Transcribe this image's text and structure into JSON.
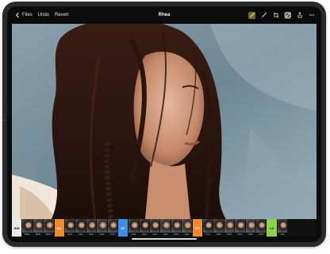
{
  "toolbar": {
    "back_label": "Files",
    "undo_label": "Undo",
    "revert_label": "Revert",
    "title": "Rhea",
    "right_icons": [
      "brush-icon",
      "wand-icon",
      "crop-icon",
      "adjust-icon",
      "share-icon",
      "more-icon"
    ]
  },
  "filmstrip": {
    "thumbnails": [
      {
        "type": "label",
        "text": "BW",
        "color": "#e9e9e9",
        "text_color": "#111"
      },
      {
        "type": "photo",
        "label": "BW1"
      },
      {
        "type": "photo",
        "label": "BW2"
      },
      {
        "type": "photo",
        "label": "BW3"
      },
      {
        "type": "label",
        "text": "CA",
        "color": "#f08a2c",
        "text_color": "#fff"
      },
      {
        "type": "photo",
        "label": "CA1"
      },
      {
        "type": "photo",
        "label": "CA2"
      },
      {
        "type": "photo",
        "label": "CA3"
      },
      {
        "type": "photo",
        "label": "CA4"
      },
      {
        "type": "photo",
        "label": "CA5"
      },
      {
        "type": "label",
        "text": "CF",
        "color": "#3a8ee6",
        "text_color": "#fff"
      },
      {
        "type": "photo",
        "label": "CF1"
      },
      {
        "type": "photo",
        "label": "CF2"
      },
      {
        "type": "photo",
        "label": "CF3"
      },
      {
        "type": "photo",
        "label": "CF4"
      },
      {
        "type": "photo",
        "label": "CF5"
      },
      {
        "type": "photo",
        "label": "CF6"
      },
      {
        "type": "label",
        "text": "FP",
        "color": "#f08a2c",
        "text_color": "#fff"
      },
      {
        "type": "photo",
        "label": "FP1"
      },
      {
        "type": "photo",
        "label": "FP2"
      },
      {
        "type": "photo",
        "label": "FP3"
      },
      {
        "type": "photo",
        "label": "FP4"
      },
      {
        "type": "photo",
        "label": "FP5"
      },
      {
        "type": "photo",
        "label": "FP6"
      },
      {
        "type": "label",
        "text": "LS",
        "color": "#8bd44a",
        "text_color": "#111"
      },
      {
        "type": "photo",
        "label": "LS1"
      }
    ]
  },
  "colors": {
    "frame": "#2a2a2c",
    "bar": "#0b0b0c",
    "accent_orange": "#f08a2c",
    "accent_blue": "#3a8ee6",
    "accent_green": "#8bd44a"
  }
}
